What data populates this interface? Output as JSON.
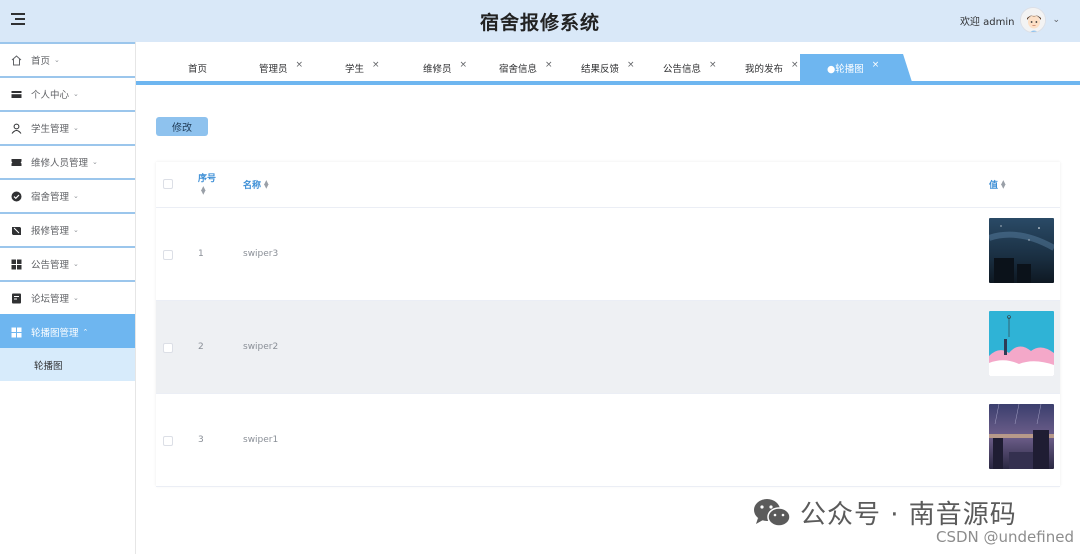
{
  "header": {
    "title": "宿舍报修系统",
    "welcome": "欢迎 admin",
    "menu_icon": "hamburger-icon",
    "avatar": "avatar",
    "bg_color": "#d9e8f8"
  },
  "sidebar": {
    "items": [
      {
        "label": "首页",
        "icon": "home-icon"
      },
      {
        "label": "个人中心",
        "icon": "card-icon"
      },
      {
        "label": "学生管理",
        "icon": "user-icon"
      },
      {
        "label": "维修人员管理",
        "icon": "ticket-icon"
      },
      {
        "label": "宿舍管理",
        "icon": "check-circle-icon"
      },
      {
        "label": "报修管理",
        "icon": "wrench-icon"
      },
      {
        "label": "公告管理",
        "icon": "grid-icon"
      },
      {
        "label": "论坛管理",
        "icon": "chat-icon"
      },
      {
        "label": "轮播图管理",
        "icon": "grid-icon"
      }
    ],
    "submenu": {
      "label": "轮播图"
    },
    "active_color": "#6eb6f0"
  },
  "tabs": [
    {
      "label": "首页",
      "closable": false
    },
    {
      "label": "管理员",
      "closable": true
    },
    {
      "label": "学生",
      "closable": true
    },
    {
      "label": "维修员",
      "closable": true
    },
    {
      "label": "宿舍信息",
      "closable": true
    },
    {
      "label": "结果反馈",
      "closable": true
    },
    {
      "label": "公告信息",
      "closable": true
    },
    {
      "label": "我的发布",
      "closable": true
    },
    {
      "label": "●轮播图",
      "closable": true
    }
  ],
  "toolbar": {
    "edit_label": "修改"
  },
  "table": {
    "columns": {
      "index": "序号",
      "name": "名称",
      "value": "值"
    },
    "rows": [
      {
        "index": "1",
        "name": "swiper3",
        "thumb": "night-sky-image"
      },
      {
        "index": "2",
        "name": "swiper2",
        "thumb": "pink-clouds-image"
      },
      {
        "index": "3",
        "name": "swiper1",
        "thumb": "city-rain-image"
      }
    ]
  },
  "watermark": {
    "main": "公众号 · 南音源码",
    "sub": "CSDN @undefined"
  }
}
